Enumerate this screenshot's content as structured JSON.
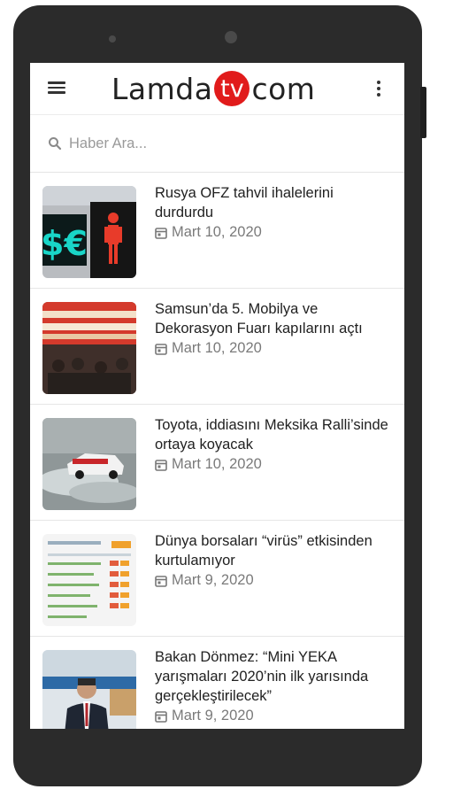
{
  "app": {
    "logo_left": "Lamda",
    "logo_tv": "tv",
    "logo_right": "com"
  },
  "search": {
    "placeholder": "Haber Ara..."
  },
  "articles": [
    {
      "title": "Rusya OFZ tahvil ihalelerini durdurdu",
      "date": "Mart 10, 2020"
    },
    {
      "title": "Samsun’da 5. Mobilya ve Dekorasyon Fuarı kapılarını açtı",
      "date": "Mart 10, 2020"
    },
    {
      "title": "Toyota, iddiasını Meksika Ralli’sinde ortaya koyacak",
      "date": "Mart 10, 2020"
    },
    {
      "title": "Dünya borsaları “virüs” etkisinden kurtulamıyor",
      "date": "Mart 9, 2020"
    },
    {
      "title": "Bakan Dönmez: “Mini YEKA yarışmaları 2020’nin ilk yarısında gerçekleştirilecek”",
      "date": "Mart 9, 2020"
    }
  ],
  "colors": {
    "brand_red": "#e11b1b",
    "device_body": "#2b2b2b"
  }
}
